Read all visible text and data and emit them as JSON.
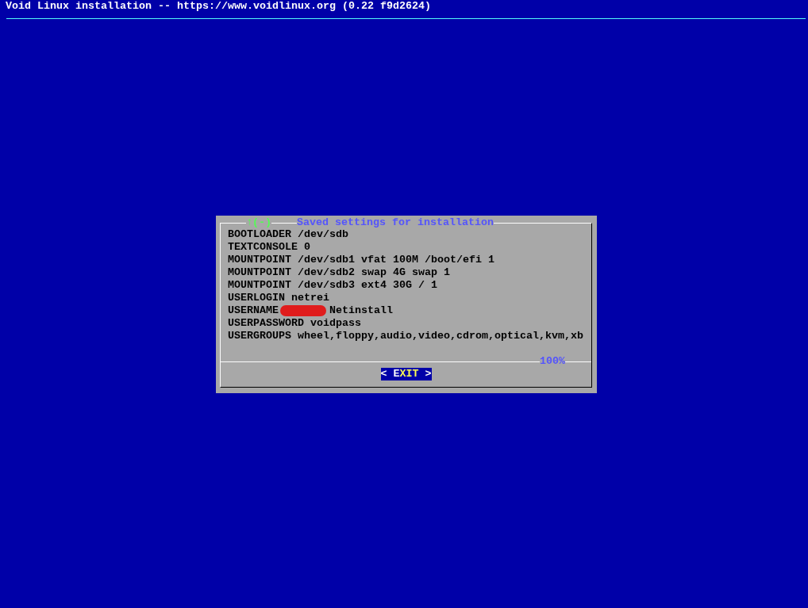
{
  "header": {
    "title": "Void Linux installation -- https://www.voidlinux.org (0.22 f9d2624)"
  },
  "dialog": {
    "scroll_indicator": "↑(-)",
    "title": "Saved settings for installation",
    "lines": [
      {
        "kind": "plain",
        "text": "BOOTLOADER /dev/sdb"
      },
      {
        "kind": "plain",
        "text": "TEXTCONSOLE 0"
      },
      {
        "kind": "plain",
        "text": "MOUNTPOINT /dev/sdb1 vfat 100M /boot/efi 1"
      },
      {
        "kind": "plain",
        "text": "MOUNTPOINT /dev/sdb2 swap 4G swap 1"
      },
      {
        "kind": "plain",
        "text": "MOUNTPOINT /dev/sdb3 ext4 30G / 1"
      },
      {
        "kind": "plain",
        "text": "USERLOGIN netrei"
      },
      {
        "kind": "redacted",
        "text": "USERNAME",
        "after": "Netinstall"
      },
      {
        "kind": "plain",
        "text": "USERPASSWORD voidpass"
      },
      {
        "kind": "plain",
        "text": "USERGROUPS wheel,floppy,audio,video,cdrom,optical,kvm,xb"
      }
    ],
    "progress": "100%",
    "button": {
      "left": "<",
      "label": "EXIT",
      "right": ">",
      "selected": true
    }
  }
}
